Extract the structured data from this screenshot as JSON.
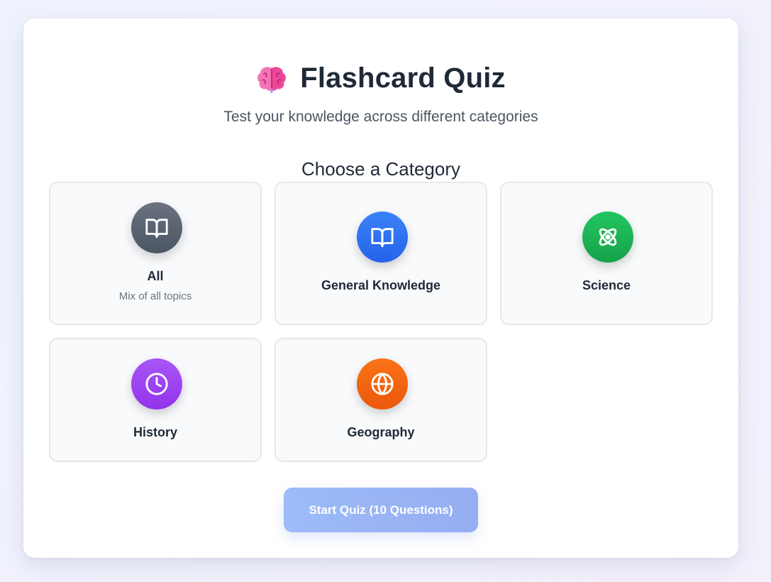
{
  "header": {
    "emoji_icon": "brain-emoji",
    "title": "Flashcard Quiz",
    "subtitle": "Test your knowledge across different categories"
  },
  "section": {
    "title": "Choose a Category"
  },
  "categories": [
    {
      "label": "All",
      "description": "Mix of all topics",
      "icon": "book-icon",
      "color": "#4b5563"
    },
    {
      "label": "General Knowledge",
      "icon": "book-icon",
      "color": "#2563eb"
    },
    {
      "label": "Science",
      "icon": "atom-icon",
      "color": "#16a34a"
    },
    {
      "label": "History",
      "icon": "clock-icon",
      "color": "#9333ea"
    },
    {
      "label": "Geography",
      "icon": "globe-icon",
      "color": "#ea580c"
    }
  ],
  "start_button": {
    "label": "Start Quiz (10 Questions)"
  }
}
